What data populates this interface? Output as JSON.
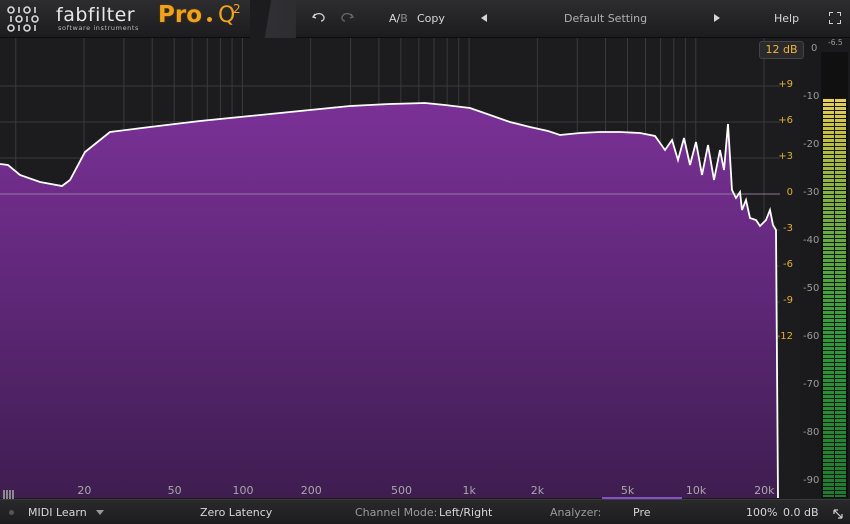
{
  "header": {
    "logo_mark": "010|010|010",
    "brand": "fabfilter",
    "brand_sub": "software instruments",
    "product": "Pro",
    "product_q": "Q",
    "product_version": "2",
    "undo_icon": "undo-icon",
    "redo_icon": "redo-icon",
    "ab_label_a": "A/",
    "ab_label_b": "B",
    "copy_label": "Copy",
    "preset_name": "Default Setting",
    "help_label": "Help",
    "fullscreen_icon": "fullscreen-icon"
  },
  "graph": {
    "range_label": "12 dB",
    "eq_db_labels": [
      "+9",
      "+6",
      "+3",
      "0",
      "-3",
      "-6",
      "-9",
      "-12"
    ],
    "analyzer_db_labels": [
      "0",
      "-10",
      "-20",
      "-30",
      "-40",
      "-50",
      "-60",
      "-70",
      "-80",
      "-90"
    ],
    "freq_labels": [
      "20",
      "50",
      "100",
      "200",
      "500",
      "1k",
      "2k",
      "5k",
      "10k",
      "20k"
    ],
    "spectrum_color": "#6b2d86",
    "curve_color": "#ffffff"
  },
  "meter": {
    "peak_readout": "-6.5",
    "level_fraction": 0.9
  },
  "footer": {
    "midi_learn": "MIDI Learn",
    "latency": "Zero Latency",
    "channel_mode_label": "Channel Mode:",
    "channel_mode_value": "Left/Right",
    "analyzer_label": "Analyzer:",
    "analyzer_value": "Pre",
    "zoom": "100%",
    "output_gain": "0.0 dB"
  }
}
